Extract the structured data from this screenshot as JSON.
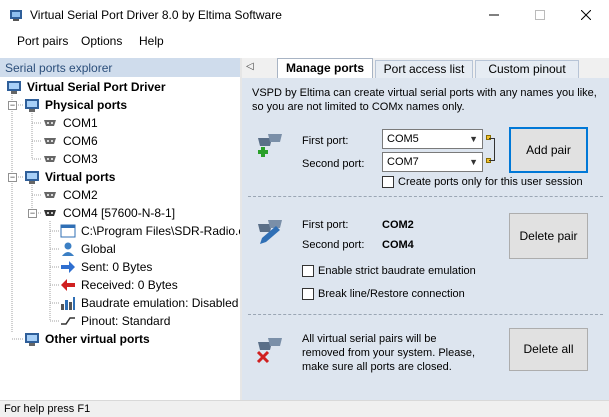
{
  "window": {
    "title": "Virtual Serial Port Driver 8.0 by Eltima Software",
    "icon": "app-icon",
    "controls": [
      "minimize-icon",
      "maximize-icon",
      "close-icon"
    ]
  },
  "menu": [
    "Port pairs",
    "Options",
    "Help"
  ],
  "sidebar": {
    "header": "Serial ports explorer",
    "root": "Virtual Serial Port Driver",
    "physical": {
      "label": "Physical ports",
      "items": [
        "COM1",
        "COM6",
        "COM3"
      ]
    },
    "virtual": {
      "label": "Virtual ports",
      "items": [
        "COM2",
        "COM4 [57600-N-8-1]"
      ],
      "details": [
        "C:\\Program Files\\SDR-Radio.c",
        "Global",
        "Sent: 0 Bytes",
        "Received: 0 Bytes",
        "Baudrate emulation: Disabled",
        "Pinout: Standard"
      ]
    },
    "other": "Other virtual ports"
  },
  "tabs": [
    "Manage ports",
    "Port access list",
    "Custom pinout"
  ],
  "active_tab": "Manage ports",
  "manage": {
    "description": "VSPD by Eltima can create virtual serial ports with any names you like, so you are not limited to COMx names only.",
    "create": {
      "first_label": "First port:",
      "first_value": "COM5",
      "second_label": "Second port:",
      "second_value": "COM7",
      "add_button": "Add pair",
      "user_only": "Create ports only for this user session"
    },
    "delete": {
      "first_label": "First port:",
      "first_value": "COM2",
      "second_label": "Second port:",
      "second_value": "COM4",
      "delete_button": "Delete pair",
      "strict_baud": "Enable strict baudrate emulation",
      "break_line": "Break line/Restore connection"
    },
    "delete_all": {
      "text": "All virtual serial pairs will be removed from your system. Please, make sure all ports are closed.",
      "button": "Delete all"
    }
  },
  "status": "For help press F1"
}
